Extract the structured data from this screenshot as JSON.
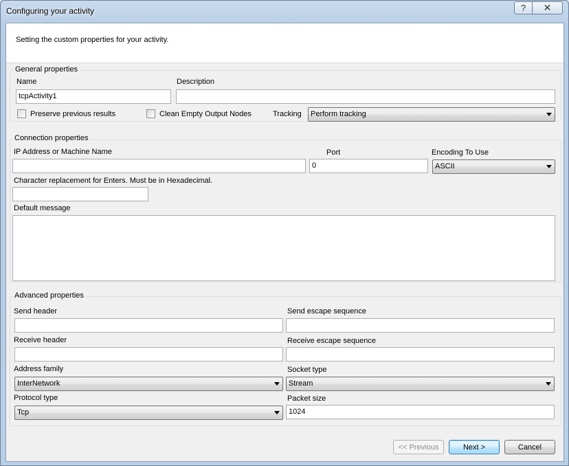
{
  "window": {
    "title": "Configuring your activity",
    "help_glyph": "?",
    "close_glyph": "✕"
  },
  "header": {
    "text": "Setting the custom properties for your activity."
  },
  "general": {
    "title": "General properties",
    "name_label": "Name",
    "name_value": "tcpActivity1",
    "description_label": "Description",
    "description_value": "",
    "preserve_label": "Preserve previous results",
    "clean_label": "Clean Empty Output Nodes",
    "tracking_label": "Tracking",
    "tracking_value": "Perform tracking"
  },
  "connection": {
    "title": "Connection properties",
    "ip_label": "IP Address or Machine Name",
    "ip_value": "",
    "port_label": "Port",
    "port_value": "0",
    "encoding_label": "Encoding To Use",
    "encoding_value": "ASCII",
    "char_label": "Character replacement for Enters. Must be in Hexadecimal.",
    "char_value": "",
    "default_label": "Default message"
  },
  "advanced": {
    "title": "Advanced properties",
    "send_header_label": "Send header",
    "send_escape_label": "Send escape sequence",
    "receive_header_label": "Receive header",
    "receive_escape_label": "Receive escape sequence",
    "address_family_label": "Address family",
    "address_family_value": "InterNetwork",
    "socket_type_label": "Socket type",
    "socket_type_value": "Stream",
    "protocol_label": "Protocol type",
    "protocol_value": "Tcp",
    "packet_label": "Packet size",
    "packet_value": "1024"
  },
  "buttons": {
    "previous": "<< Previous",
    "next": "Next >",
    "cancel": "Cancel"
  }
}
